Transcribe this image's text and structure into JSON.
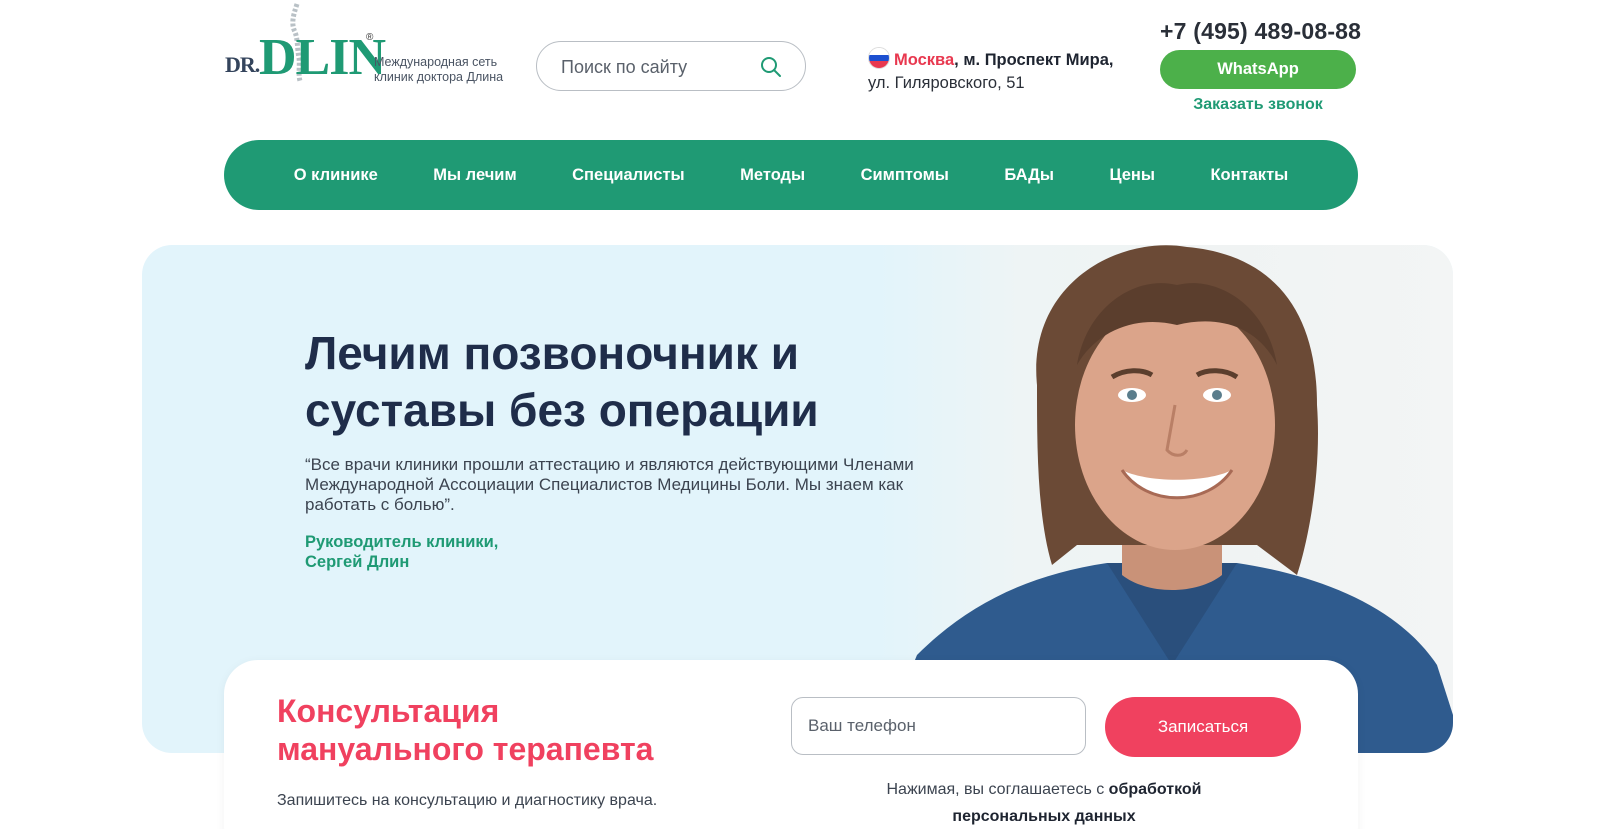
{
  "header": {
    "logo_dr": "DR.",
    "logo_dlin": "DLIN",
    "logo_reg": "®",
    "tagline": "Международная сеть клиник доктора Длина",
    "search_placeholder": "Поиск по сайту",
    "search_icon": "search-icon",
    "location_city": "Москва",
    "location_metro": ", м. Проспект Мира,",
    "location_street": "ул. Гиляровского, 51",
    "phone": "+7 (495) 489-08-88",
    "whatsapp_label": "WhatsApp",
    "callback_label": "Заказать звонок"
  },
  "nav": {
    "items": [
      "О клинике",
      "Мы лечим",
      "Специалисты",
      "Методы",
      "Симптомы",
      "БАДы",
      "Цены",
      "Контакты"
    ]
  },
  "hero": {
    "title": "Лечим позвоночник и суставы без операции",
    "quote": "“Все врачи клиники прошли аттестацию и являются действующими Членами Международной Ассоциации Специалистов Медицины Боли. Мы знаем как работать с болью”.",
    "author_line1": "Руководитель клиники,",
    "author_line2": "Сергей Длин"
  },
  "consultation": {
    "title": "Консультация мануального терапевта",
    "subtitle": "Запишитесь на консультацию и диагностику врача.",
    "phone_placeholder": "Ваш телефон",
    "submit_label": "Записаться",
    "agree_prefix": "Нажимая, вы соглашаетесь с",
    "agree_link": "обработкой персональных данных"
  },
  "colors": {
    "brand_green": "#1f9a74",
    "whatsapp_green": "#4cb04a",
    "accent_red": "#f0415f",
    "hero_bg": "#e2f4fb",
    "heading_navy": "#1f2d4a"
  }
}
